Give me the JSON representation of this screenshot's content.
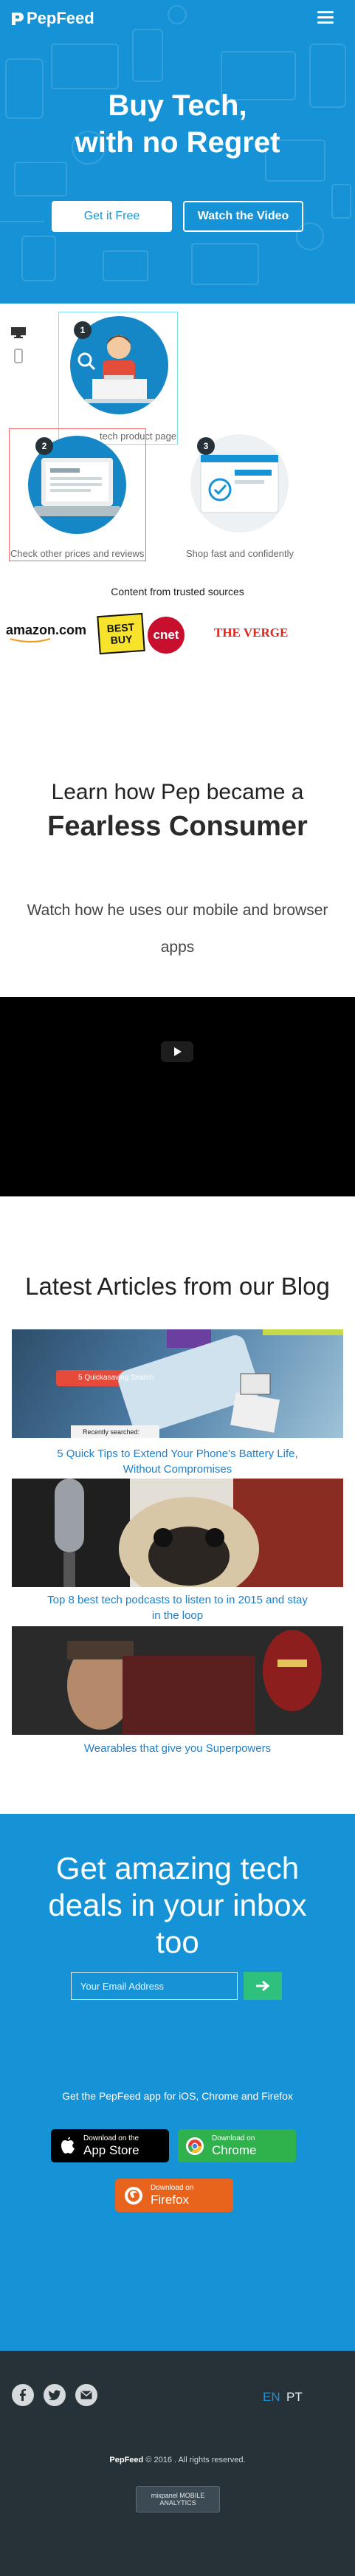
{
  "header": {
    "brand": "PepFeed",
    "menu_icon": "hamburger-menu-icon"
  },
  "hero": {
    "title_line1": "Buy Tech,",
    "title_line2": "with no Regret",
    "primary_button": "Get it Free",
    "secondary_button": "Watch the Video",
    "background_color": "#1693d6"
  },
  "steps": {
    "items": [
      {
        "number": "1",
        "caption": "tech product page"
      },
      {
        "number": "2",
        "caption": "Check other prices and reviews"
      },
      {
        "number": "3",
        "caption": "Shop fast and confidently"
      }
    ]
  },
  "trusted": {
    "heading": "Content from trusted sources",
    "logos": [
      "amazon.com",
      "BEST BUY",
      "cnet",
      "THE VERGE"
    ]
  },
  "learn": {
    "line1": "Learn how Pep became a",
    "line2": "Fearless Consumer",
    "sub_line1": "Watch how he uses our mobile and browser",
    "sub_line2": "apps"
  },
  "blog": {
    "title": "Latest Articles from our Blog",
    "image_overlay_1": "5 Quickasaving Search",
    "image_overlay_2": "Recently searched:",
    "articles": [
      {
        "line1": "5 Quick Tips to Extend Your Phone's Battery Life,",
        "line2": "Without Compromises"
      },
      {
        "line1": "Top 8 best tech podcasts to listen to in 2015 and stay",
        "line2": "in the loop"
      },
      {
        "line1": "Wearables that give you Superpowers",
        "line2": ""
      }
    ]
  },
  "newsletter": {
    "title_line1": "Get amazing tech",
    "title_line2": "deals in your inbox",
    "title_line3": "too",
    "email_placeholder": "Your Email Address",
    "submit_icon": "arrow-right-icon",
    "get_app_text": "Get the PepFeed app for iOS, Chrome and Firefox",
    "stores": [
      {
        "small": "Download on the",
        "big": "App Store",
        "color": "#000000"
      },
      {
        "small": "Download on",
        "big": "Chrome",
        "color": "#2fb24c"
      },
      {
        "small": "Download on",
        "big": "Firefox",
        "color": "#e8641c"
      }
    ]
  },
  "footer": {
    "social_icons": [
      "facebook-icon",
      "twitter-icon",
      "email-icon"
    ],
    "lang_en": "EN",
    "lang_pt": "PT",
    "copyright_brand": "PepFeed",
    "copyright_text": "© 2016 . All rights reserved.",
    "badge_line1": "mixpanel MOBILE",
    "badge_line2": "ANALYTICS",
    "accent": "#1693d6"
  }
}
